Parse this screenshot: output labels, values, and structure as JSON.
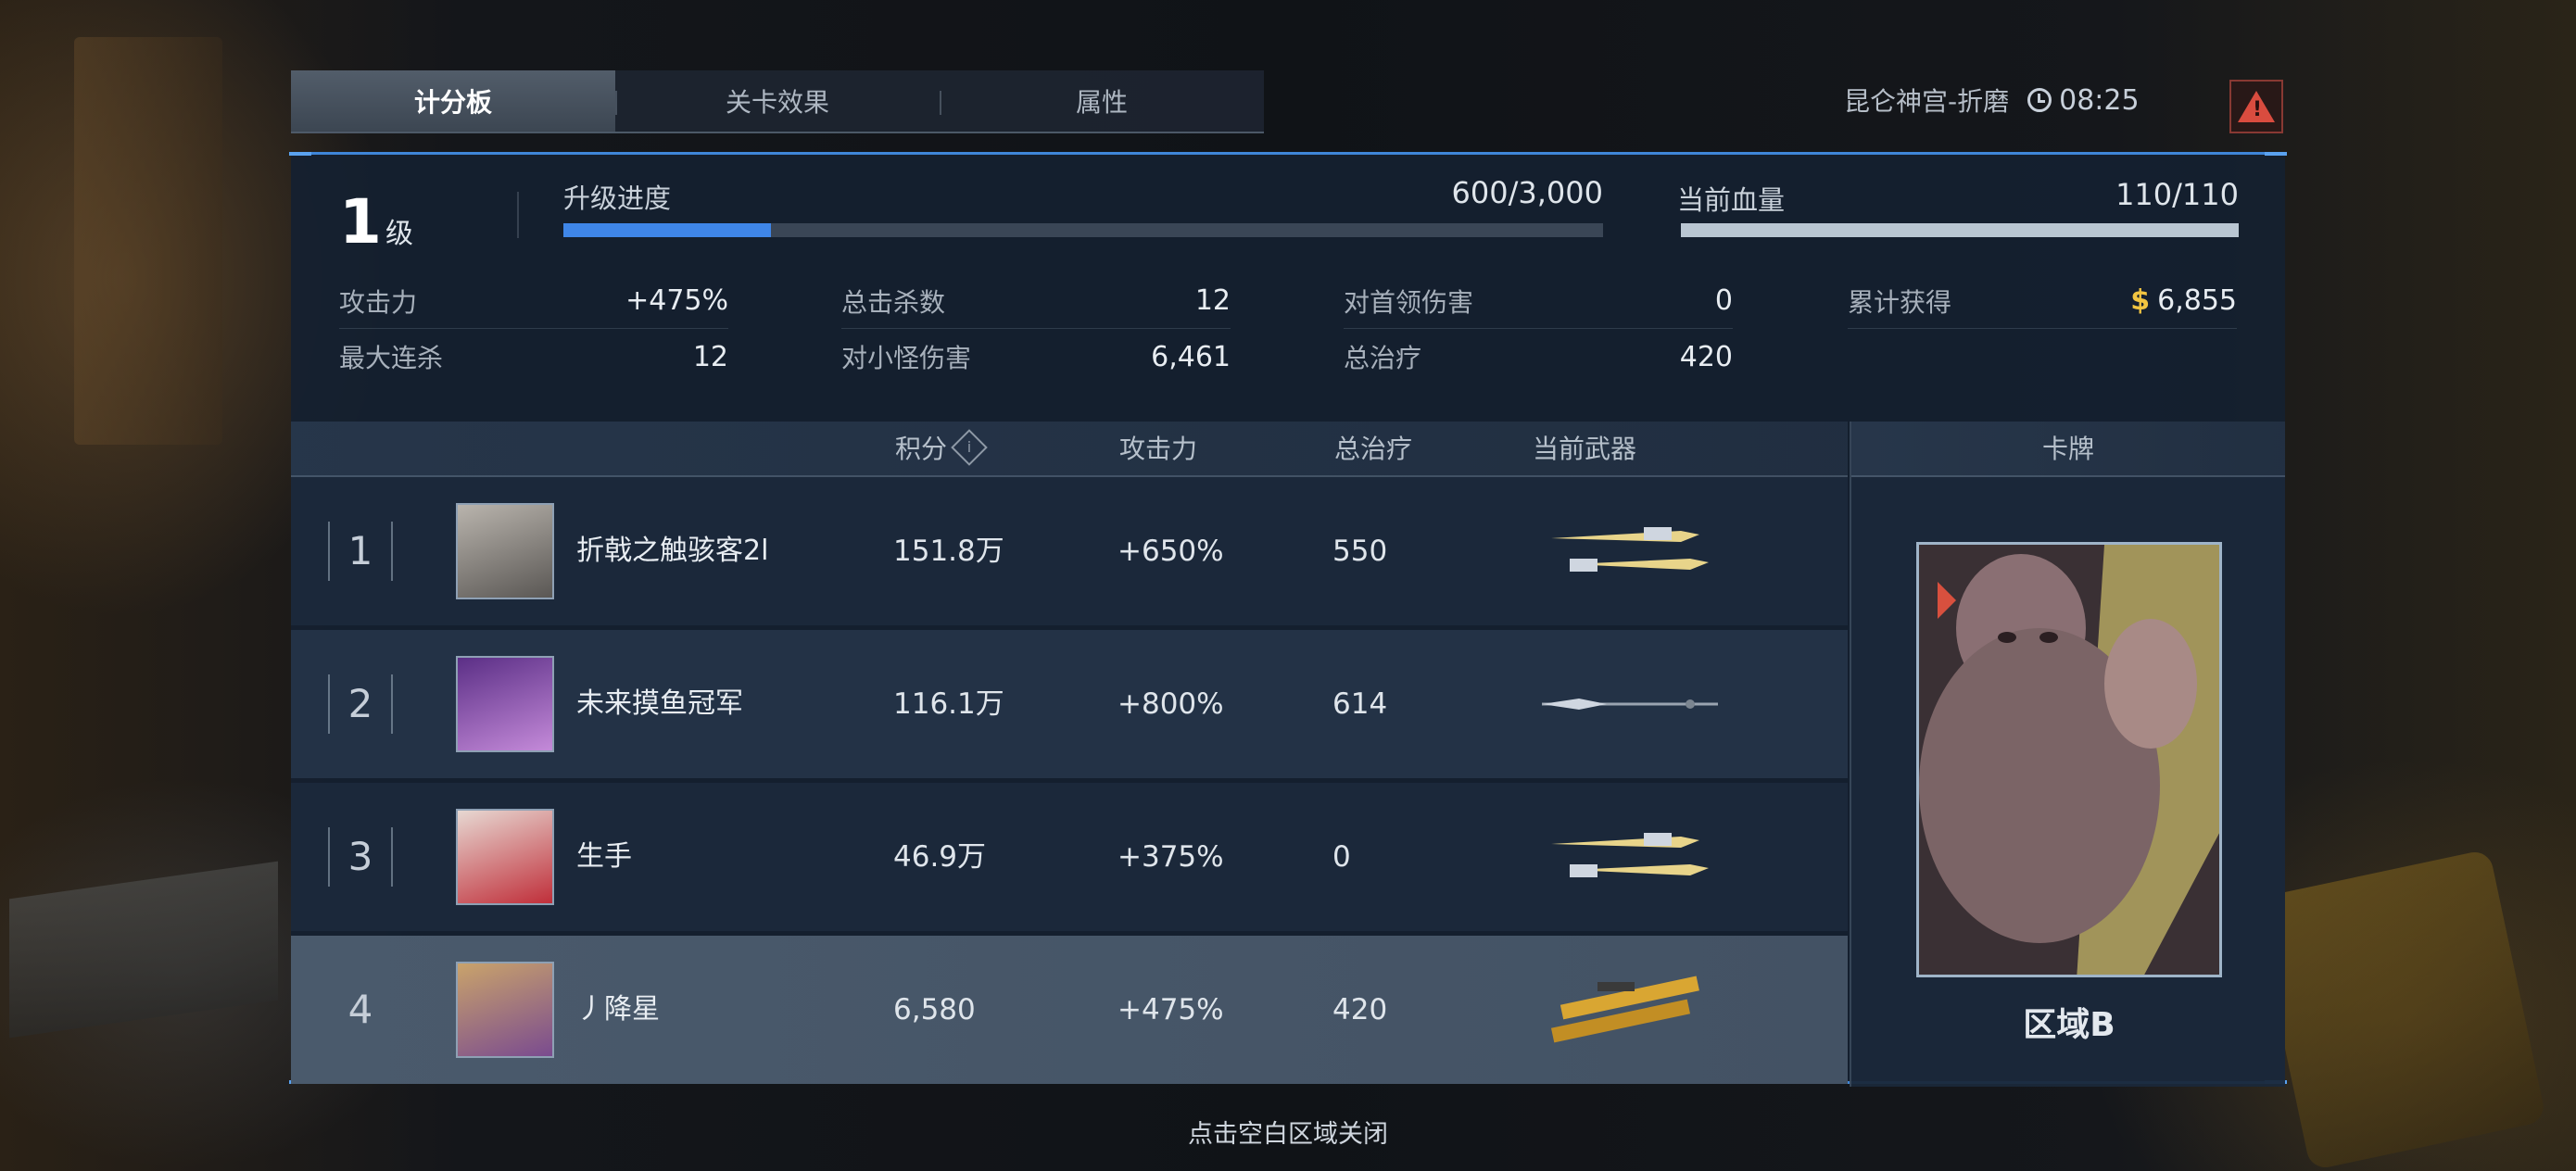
{
  "tabs": [
    {
      "label": "计分板",
      "active": true
    },
    {
      "label": "关卡效果",
      "active": false
    },
    {
      "label": "属性",
      "active": false
    }
  ],
  "status": {
    "location": "昆仑神宫-折磨",
    "time": "08:25",
    "clock_icon": "clock-icon",
    "alert_icon": "warning-triangle-icon",
    "alert_glyph": "!"
  },
  "level": {
    "value": "1",
    "unit": "级"
  },
  "progress": {
    "label": "升级进度",
    "value_text": "600/3,000",
    "current": 600,
    "max": 3000,
    "color": "#3f86e8"
  },
  "health": {
    "label": "当前血量",
    "value_text": "110/110",
    "current": 110,
    "max": 110,
    "color": "#b9c6d2"
  },
  "stats": [
    {
      "key": "攻击力",
      "value": "+475%"
    },
    {
      "key": "最大连杀",
      "value": "12"
    },
    {
      "key": "总击杀数",
      "value": "12"
    },
    {
      "key": "对小怪伤害",
      "value": "6,461"
    },
    {
      "key": "对首领伤害",
      "value": "0"
    },
    {
      "key": "总治疗",
      "value": "420"
    },
    {
      "key": "累计获得",
      "value": "6,855",
      "icon": "coin-icon",
      "coin_glyph": "$"
    }
  ],
  "table": {
    "headers": {
      "score": "积分",
      "score_info_glyph": "i",
      "attack": "攻击力",
      "heal": "总治疗",
      "weapon": "当前武器"
    },
    "rows": [
      {
        "rank": "1",
        "name": "折戟之触骇客2l",
        "score": "151.8万",
        "attack": "+650%",
        "heal": "550",
        "weapon": "twin-daggers-icon",
        "highlight": false
      },
      {
        "rank": "2",
        "name": "未来摸鱼冠军",
        "score": "116.1万",
        "attack": "+800%",
        "heal": "614",
        "weapon": "spear-icon",
        "highlight": false
      },
      {
        "rank": "3",
        "name": "生手",
        "score": "46.9万",
        "attack": "+375%",
        "heal": "0",
        "weapon": "twin-daggers-icon",
        "highlight": false
      },
      {
        "rank": "4",
        "name": "丿降星",
        "score": "6,580",
        "attack": "+475%",
        "heal": "420",
        "weapon": "golden-rifles-icon",
        "highlight": true
      }
    ]
  },
  "card": {
    "title": "卡牌",
    "zone": "区域B"
  },
  "close_hint": "点击空白区域关闭"
}
